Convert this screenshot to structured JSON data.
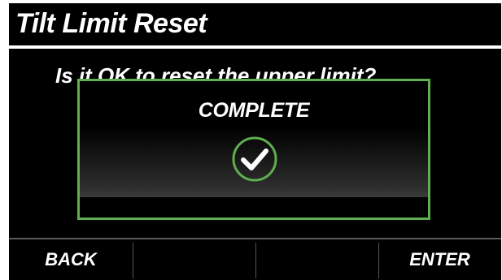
{
  "header": {
    "title": "Tilt Limit Reset"
  },
  "body": {
    "question": "Is it OK to reset the upper limit?"
  },
  "dialog": {
    "title": "COMPLETE",
    "icon": "check-circle-icon",
    "accent": "#5fae50"
  },
  "softkeys": {
    "key1": "BACK",
    "key2": "",
    "key3": "",
    "key4": "ENTER"
  }
}
